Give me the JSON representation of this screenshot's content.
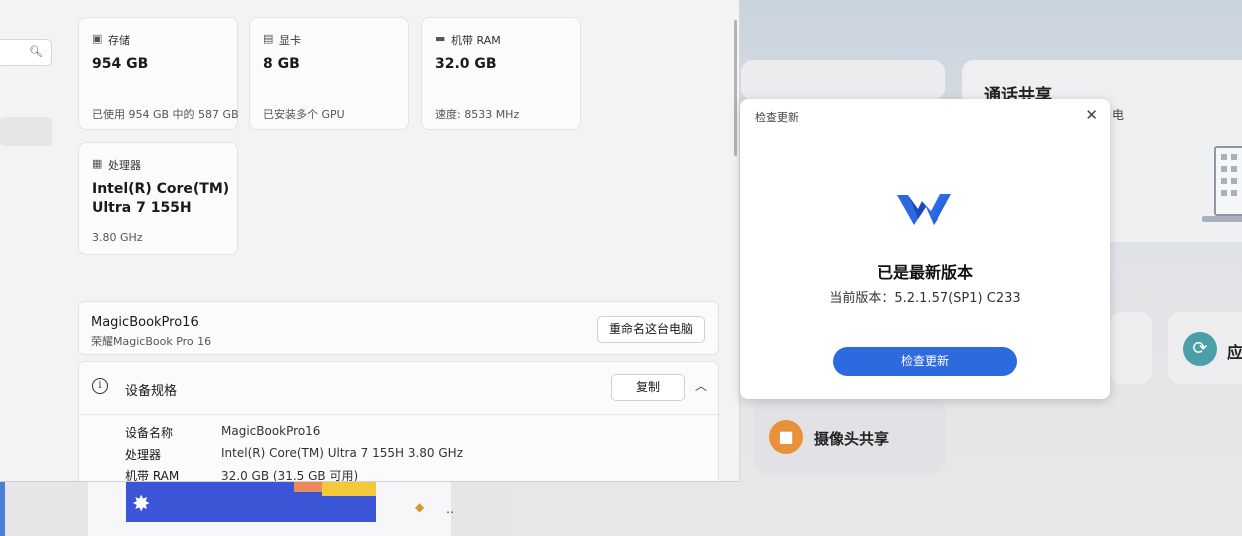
{
  "settings": {
    "tiles": {
      "storage": {
        "icon": "storage-icon",
        "label": "存储",
        "value": "954 GB",
        "sub": "已使用 954 GB 中的 587 GB"
      },
      "gpu": {
        "icon": "gpu-icon",
        "label": "显卡",
        "value": "8 GB",
        "sub": "已安装多个 GPU"
      },
      "ram": {
        "icon": "ram-icon",
        "label": "机带 RAM",
        "value": "32.0 GB",
        "sub": "速度: 8533 MHz"
      },
      "cpu": {
        "icon": "processor-icon",
        "label": "处理器",
        "value": "Intel(R) Core(TM) Ultra 7 155H",
        "sub": "3.80 GHz"
      }
    },
    "pc": {
      "name": "MagicBookPro16",
      "model": "荣耀MagicBook Pro 16",
      "rename_label": "重命名这台电脑"
    },
    "specs": {
      "title": "设备规格",
      "copy_label": "复制",
      "rows": [
        {
          "key": "设备名称",
          "value": "MagicBookPro16"
        },
        {
          "key": "处理器",
          "value": "Intel(R) Core(TM) Ultra 7 155H   3.80 GHz"
        },
        {
          "key": "机带 RAM",
          "value": "32.0 GB (31.5 GB 可用)"
        }
      ]
    }
  },
  "dialog": {
    "title": "检查更新",
    "status": "已是最新版本",
    "version": "当前版本：5.2.1.57(SP1) C233",
    "button_label": "检查更新",
    "accent_color": "#2d6ae0"
  },
  "background": {
    "call_share_title": "通话共享",
    "call_share_sub": "电",
    "app_label": "应",
    "camera_share_label": "摄像头共享"
  }
}
